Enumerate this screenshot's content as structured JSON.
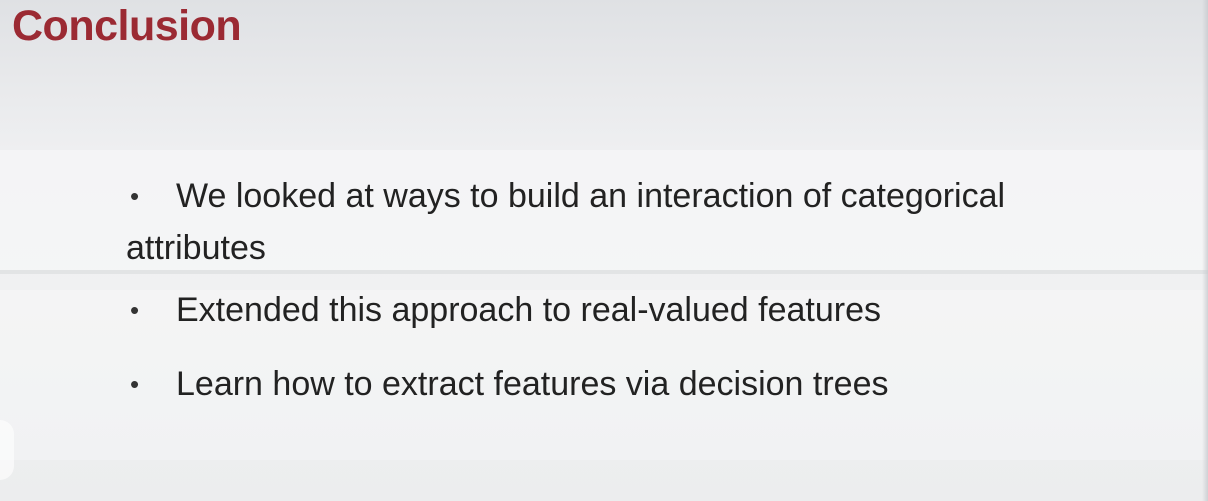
{
  "slide": {
    "title": "Conclusion",
    "bullets": [
      "We looked at ways to build an interaction of categorical attributes",
      "Extended this approach to real-valued features",
      "Learn how to extract features via decision trees"
    ],
    "bullet_symbol": "•",
    "title_color": "#9b2a33"
  }
}
